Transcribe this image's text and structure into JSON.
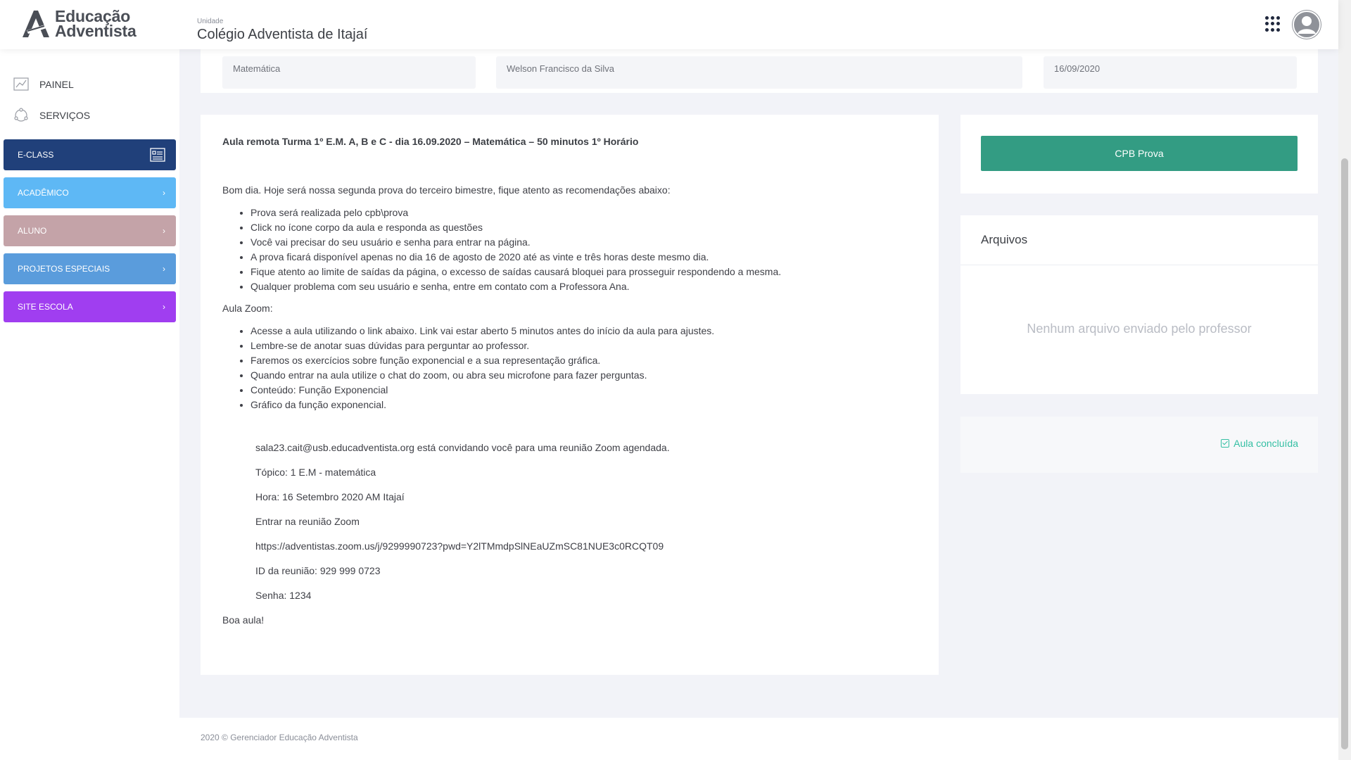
{
  "header": {
    "brand_line1": "Educação",
    "brand_line2": "Adventista",
    "unit_label": "Unidade",
    "unit_name": "Colégio Adventista de Itajaí"
  },
  "sidebar": {
    "links": [
      {
        "label": "PAINEL",
        "icon": "chart-icon"
      },
      {
        "label": "SERVIÇOS",
        "icon": "services-icon"
      }
    ],
    "buttons": [
      {
        "label": "E-CLASS",
        "color": "#20407a",
        "icon": "list-card-icon"
      },
      {
        "label": "ACADÊMICO",
        "color": "#5eb8f5",
        "icon": "chevron-right-icon"
      },
      {
        "label": "ALUNO",
        "color": "#c4a3a8",
        "icon": "chevron-right-icon"
      },
      {
        "label": "PROJETOS ESPECIAIS",
        "color": "#5a9cdc",
        "icon": "chevron-right-icon"
      },
      {
        "label": "SITE ESCOLA",
        "color": "#a03ef0",
        "icon": "chevron-right-icon"
      }
    ]
  },
  "top_fields": {
    "subject": "Matemática",
    "teacher": "Welson Francisco da Silva",
    "date": "16/09/2020"
  },
  "content": {
    "title": "Aula remota Turma 1º E.M. A, B e C - dia 16.09.2020 – Matemática – 50 minutos 1º Horário",
    "intro": "Bom dia. Hoje será nossa segunda prova do terceiro bimestre, fique atento as recomendações abaixo:",
    "list1": [
      "Prova será realizada pelo cpb\\prova",
      "Click no ícone corpo da aula e responda as questões",
      "Você vai precisar do seu usuário e senha para entrar na página.",
      "A prova ficará disponível apenas no dia 16 de agosto de 2020 até as vinte e três horas deste mesmo dia.",
      "Fique atento ao limite de saídas da página, o excesso de saídas causará bloquei para prosseguir respondendo a mesma.",
      "Qualquer problema com seu usuário e senha, entre em contato com a Professora Ana."
    ],
    "zoom_heading": "Aula Zoom:",
    "list2": [
      "Acesse a aula utilizando o link abaixo. Link vai estar aberto 5 minutos antes do início da aula para ajustes.",
      "Lembre-se de anotar suas dúvidas para perguntar ao professor.",
      "Faremos os exercícios sobre função exponencial e a sua representação gráfica.",
      "Quando entrar na aula utilize o chat do zoom, ou abra seu microfone para fazer perguntas.",
      "Conteúdo: Função Exponencial",
      "Gráfico da função exponencial."
    ],
    "zoom_lines": [
      "sala23.cait@usb.educadventista.org está convidando você para uma reunião Zoom agendada.",
      "Tópico: 1 E.M - matemática",
      "Hora: 16 Setembro 2020 AM Itajaí",
      "Entrar na reunião Zoom",
      "https://adventistas.zoom.us/j/9299990723?pwd=Y2lTMmdpSlNEaUZmSC81NUE3c0RCQT09",
      "ID da reunião: 929 999 0723",
      "Senha: 1234"
    ],
    "closing": "Boa aula!"
  },
  "right": {
    "cpb_button": "CPB Prova",
    "files_title": "Arquivos",
    "files_empty": "Nenhum arquivo enviado pelo professor",
    "done_label": "Aula concluída"
  },
  "footer": {
    "text": "2020 © Gerenciador Educação Adventista"
  }
}
